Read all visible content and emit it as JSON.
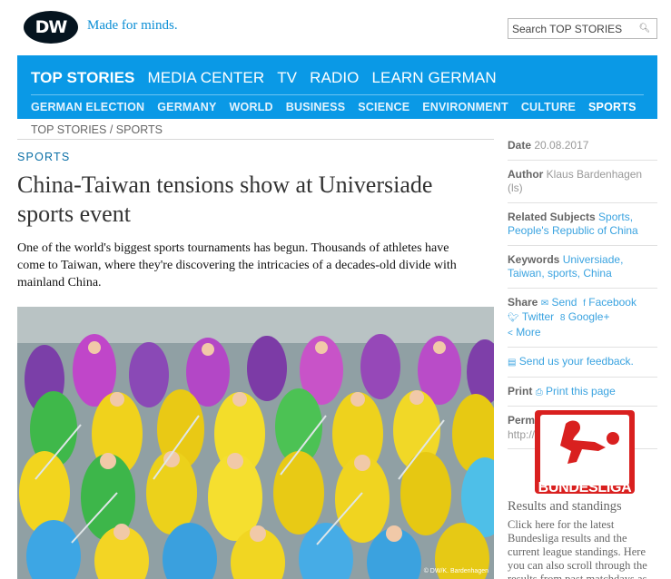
{
  "header": {
    "logo_text": "DW",
    "slogan": "Made for minds.",
    "search_placeholder": "Search TOP STORIES",
    "search_icon": "search-icon"
  },
  "nav": {
    "main": [
      "TOP STORIES",
      "MEDIA CENTER",
      "TV",
      "RADIO",
      "LEARN GERMAN"
    ],
    "sub": [
      "GERMAN ELECTION",
      "GERMANY",
      "WORLD",
      "BUSINESS",
      "SCIENCE",
      "ENVIRONMENT",
      "CULTURE",
      "SPORTS"
    ],
    "active_main": "TOP STORIES",
    "active_sub": "SPORTS",
    "color": "#0a99e6"
  },
  "breadcrumb": {
    "first": "TOP STORIES",
    "separator": " / ",
    "second": "SPORTS"
  },
  "article": {
    "category": "SPORTS",
    "title": "China-Taiwan tensions show at Universiade sports event",
    "intro": "One of the world's biggest sports tournaments has begun. Thousands of athletes have come to Taiwan, where they're discovering the intricacies of a decades-old divide with mainland China.",
    "photo_credit": "© DW/K. Bardenhagen"
  },
  "sidebar": {
    "date_label": "Date",
    "date_value": "20.08.2017",
    "author_label": "Author",
    "author_value": "Klaus Bardenhagen (ls)",
    "related_label": "Related Subjects",
    "related_1": "Sports,",
    "related_2": "People's Republic of China",
    "keywords_label": "Keywords",
    "keywords_1": "Universiade,",
    "keywords_2": "Taiwan,",
    "keywords_3": "sports,",
    "keywords_4": "China",
    "share_label": "Share",
    "share_send": "Send",
    "share_facebook": "Facebook",
    "share_twitter": "Twitter",
    "share_google": "Google+",
    "share_more": "More",
    "feedback": "Send us your feedback.",
    "print_label": "Print",
    "print_link": "Print this page",
    "permalink_label": "Permalink",
    "permalink_value": "http://p.dw.com/p/2iXJu"
  },
  "promo": {
    "logo_text": "BUNDESLIGA",
    "title": "Results and standings",
    "body": "Click here for the latest Bundesliga results and the current league standings. Here you can also scroll through the results from past matchdays as"
  }
}
